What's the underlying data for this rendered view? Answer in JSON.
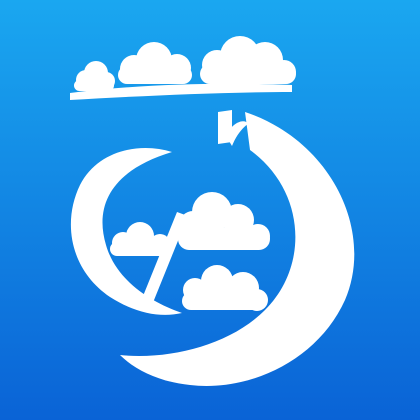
{
  "icon": {
    "name": "weather-app-icon",
    "colors": {
      "gradient_top": "#1aa7f0",
      "gradient_bottom": "#0a63d6",
      "foreground": "#ffffff"
    }
  }
}
